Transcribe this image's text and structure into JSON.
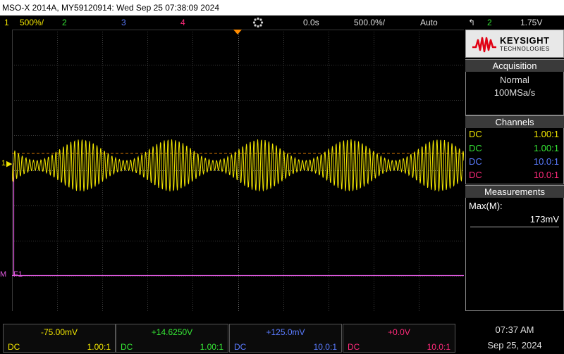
{
  "title": "MSO-X 2014A, MY59120914: Wed Sep 25 07:38:09 2024",
  "status": {
    "ch1_num": "1",
    "ch1_scale": "500%/",
    "ch2_num": "2",
    "ch3_num": "3",
    "ch4_num": "4",
    "time_delay": "0.0s",
    "time_scale": "500.0%/",
    "trigger_mode": "Auto",
    "trigger_source": "2",
    "trigger_level": "1.75V"
  },
  "logo": {
    "line1": "KEYSIGHT",
    "line2": "TECHNOLOGIES"
  },
  "acquisition": {
    "header": "Acquisition",
    "mode": "Normal",
    "rate": "100MSa/s"
  },
  "channels": {
    "header": "Channels",
    "rows": [
      {
        "coupling": "DC",
        "ratio": "1.00:1",
        "color": "#f2e600"
      },
      {
        "coupling": "DC",
        "ratio": "1.00:1",
        "color": "#35e635"
      },
      {
        "coupling": "DC",
        "ratio": "10.0:1",
        "color": "#5a7bff"
      },
      {
        "coupling": "DC",
        "ratio": "10.0:1",
        "color": "#ff2a7a"
      }
    ]
  },
  "measurements": {
    "header": "Measurements",
    "label": "Max(M):",
    "value": "173mV"
  },
  "markers": {
    "ch1": "1",
    "math": "F1",
    "math_prefix": "M"
  },
  "bottom": [
    {
      "value": "-75.00mV",
      "coupling": "DC",
      "ratio": "1.00:1",
      "color": "#f2e600"
    },
    {
      "value": "+14.6250V",
      "coupling": "DC",
      "ratio": "1.00:1",
      "color": "#35e635"
    },
    {
      "value": "+125.0mV",
      "coupling": "DC",
      "ratio": "10.0:1",
      "color": "#5a7bff"
    },
    {
      "value": "+0.0V",
      "coupling": "DC",
      "ratio": "10.0:1",
      "color": "#ff2a7a"
    }
  ],
  "clock": {
    "time": "07:37 AM",
    "date": "Sep 25, 2024"
  },
  "colors": {
    "ch1": "#f2e600",
    "ch2": "#35e635",
    "ch3": "#5a7bff",
    "ch4": "#ff2a7a",
    "math": "#e05ae0",
    "trigger": "#ff8c00",
    "grid": "#3a3a3a"
  }
}
